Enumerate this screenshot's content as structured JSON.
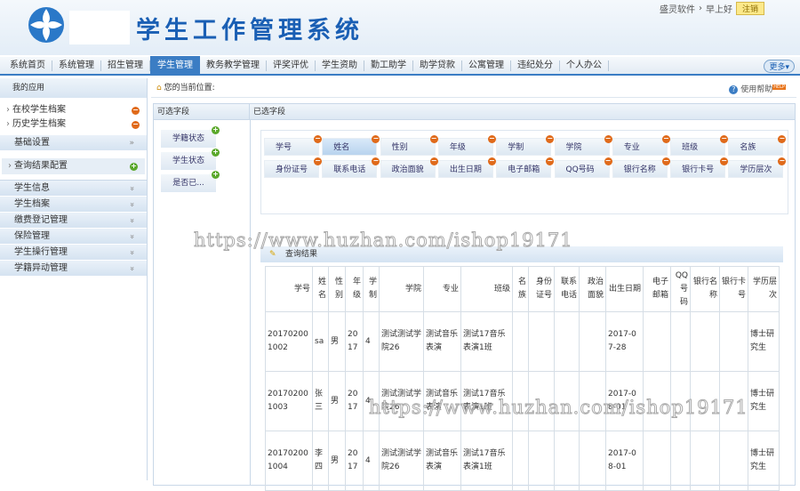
{
  "header": {
    "title": "学生工作管理系统",
    "company": "盛灵软件",
    "greeting": "早上好",
    "logout": "注销"
  },
  "nav": {
    "items": [
      "系统首页",
      "系统管理",
      "招生管理",
      "学生管理",
      "教务教学管理",
      "评奖评优",
      "学生资助",
      "勤工助学",
      "助学贷款",
      "公寓管理",
      "违纪处分",
      "个人办公"
    ],
    "active": 3,
    "more": "更多▾"
  },
  "sidebar": {
    "my_apps": "我的应用",
    "links": [
      "在校学生档案",
      "历史学生档案"
    ],
    "basic": "基础设置",
    "config": "查询结果配置",
    "groups": [
      "学生信息",
      "学生档案",
      "缴费登记管理",
      "保险管理",
      "学生操行管理",
      "学籍异动管理"
    ]
  },
  "main": {
    "breadcrumb": "您的当前位置:",
    "help": "使用帮助",
    "help_badge": "HELP",
    "available_label": "可选字段",
    "selected_label": "已选字段",
    "available": [
      "学籍状态",
      "学生状态",
      "是否已..."
    ],
    "selected": [
      "学号",
      "姓名",
      "性别",
      "年级",
      "学制",
      "学院",
      "专业",
      "班级",
      "名族",
      "身份证号",
      "联系电话",
      "政治面貌",
      "出生日期",
      "电子邮箱",
      "QQ号码",
      "银行名称",
      "银行卡号",
      "学历层次"
    ],
    "selected_active": 1,
    "results_title": "查询结果",
    "columns": [
      "学号",
      "姓名",
      "性别",
      "年级",
      "学制",
      "学院",
      "专业",
      "班级",
      "名族",
      "身份证号",
      "联系电话",
      "政治面貌",
      "出生日期",
      "电子邮箱",
      "QQ号码",
      "银行名称",
      "银行卡号",
      "学历层次"
    ],
    "rows": [
      [
        "201702001002",
        "sa",
        "男",
        "2017",
        "4",
        "测试测试学院26",
        "测试音乐表演",
        "测试17音乐表演1班",
        "",
        "",
        "",
        "",
        "2017-07-28",
        "",
        "",
        "",
        "",
        "博士研究生"
      ],
      [
        "201702001003",
        "张三",
        "男",
        "2017",
        "4",
        "测试测试学院26",
        "测试音乐表演",
        "测试17音乐表演1班",
        "",
        "",
        "",
        "",
        "2017-08-01",
        "",
        "",
        "",
        "",
        "博士研究生"
      ],
      [
        "201702001004",
        "李四",
        "男",
        "2017",
        "4",
        "测试测试学院26",
        "测试音乐表演",
        "测试17音乐表演1班",
        "",
        "",
        "",
        "",
        "2017-08-01",
        "",
        "",
        "",
        "",
        "博士研究生"
      ]
    ]
  },
  "watermark": "https://www.huzhan.com/ishop19171"
}
